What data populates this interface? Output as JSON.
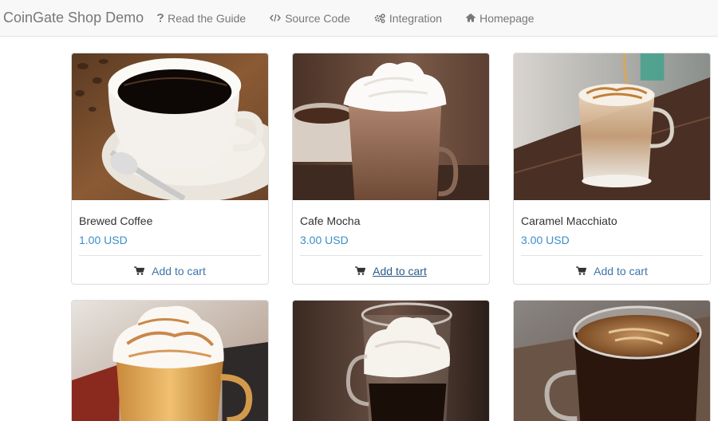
{
  "navbar": {
    "brand": "CoinGate Shop Demo",
    "links": [
      {
        "label": "Read the Guide",
        "icon": "question-icon"
      },
      {
        "label": "Source Code",
        "icon": "code-icon"
      },
      {
        "label": "Integration",
        "icon": "cogs-icon"
      },
      {
        "label": "Homepage",
        "icon": "home-icon"
      }
    ]
  },
  "products": [
    {
      "name": "Brewed Coffee",
      "price": "1.00 USD",
      "cart_label": "Add to cart",
      "hovered": false
    },
    {
      "name": "Cafe Mocha",
      "price": "3.00 USD",
      "cart_label": "Add to cart",
      "hovered": true
    },
    {
      "name": "Caramel Macchiato",
      "price": "3.00 USD",
      "cart_label": "Add to cart",
      "hovered": false
    },
    {
      "name": "",
      "price": "",
      "cart_label": ""
    },
    {
      "name": "",
      "price": "",
      "cart_label": ""
    },
    {
      "name": "",
      "price": "",
      "cart_label": ""
    }
  ],
  "colors": {
    "navbar_bg": "#f8f8f8",
    "price": "#3a8fc6",
    "link": "#3f75a8"
  }
}
